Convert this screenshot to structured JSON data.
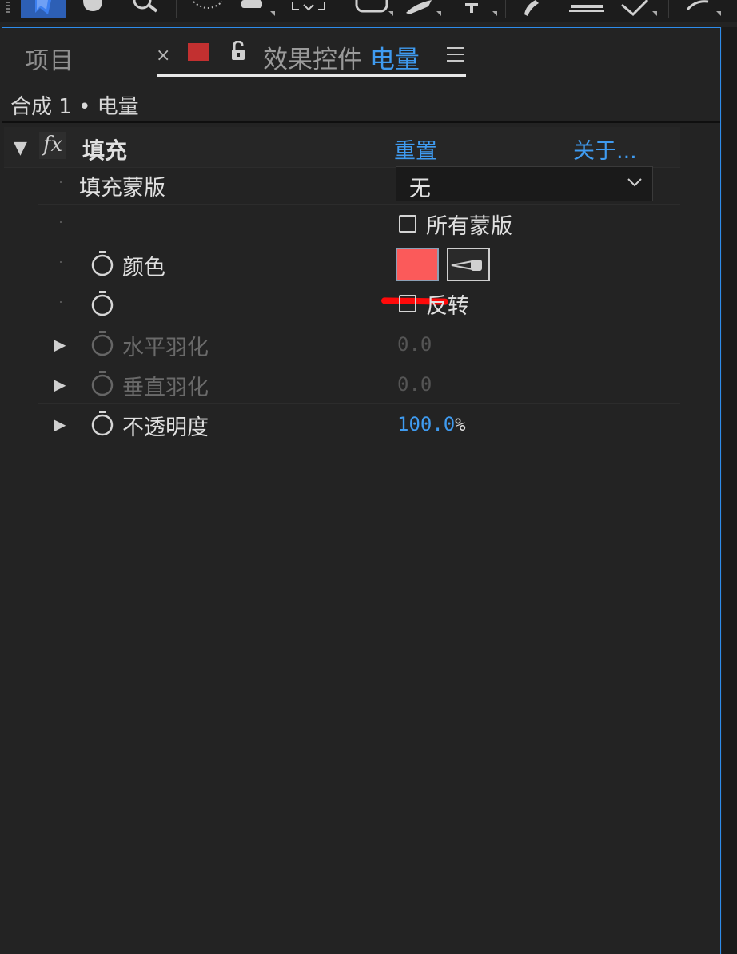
{
  "panel": {
    "tab_project": "项目",
    "tab_close": "×",
    "tab_title_prefix": "效果控件 ",
    "tab_title_layer": "电量",
    "breadcrumb": "合成 1 • 电量"
  },
  "effect": {
    "fx_icon": "fx",
    "name": "填充",
    "reset_label": "重置",
    "about_label": "关于...",
    "fill_mask_label": "填充蒙版",
    "fill_mask_value": "无",
    "all_masks_label": "所有蒙版",
    "all_masks_checked": false,
    "color_label": "颜色",
    "color_value": "#fb5a5a",
    "invert_label": "反转",
    "invert_checked": false,
    "h_feather_label": "水平羽化",
    "h_feather_value": "0.0",
    "v_feather_label": "垂直羽化",
    "v_feather_value": "0.0",
    "opacity_label": "不透明度",
    "opacity_value": "100.0",
    "opacity_unit": "%"
  },
  "colors": {
    "accent": "#3f9bf0",
    "panel_border": "#2d8ceb",
    "tab_swatch": "#c23030",
    "annotation": "#ff0a0a"
  },
  "icons": [
    "selection-tool-icon",
    "hand-tool-icon",
    "zoom-tool-icon",
    "rotate-tool-icon",
    "camera-tool-icon",
    "anchor-tool-icon",
    "shape-tool-icon",
    "pen-tool-icon",
    "text-tool-icon",
    "brush-tool-icon",
    "stamp-tool-icon",
    "eraser-tool-icon",
    "puppet-tool-icon",
    "lock-icon",
    "panel-menu-icon",
    "stopwatch-icon",
    "eyedropper-icon",
    "chevron-down-icon"
  ]
}
